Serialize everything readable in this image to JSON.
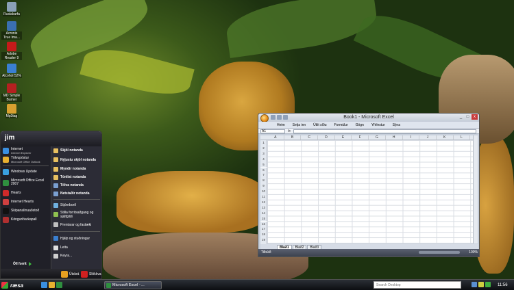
{
  "desktop": {
    "icons": [
      {
        "label": "Ruslakarfa",
        "icon": "recycle-bin-icon",
        "color": "#8aa0b8"
      },
      {
        "label": "Acronis True Ima...",
        "icon": "acronis-icon",
        "color": "#3a6fb0"
      },
      {
        "label": "Adobe Reader 9",
        "icon": "adobe-reader-icon",
        "color": "#c41a1a"
      },
      {
        "label": "Alcohol 52%",
        "icon": "alcohol-icon",
        "color": "#3a7fd0"
      },
      {
        "label": "MD Simple Burner",
        "icon": "md-burner-icon",
        "color": "#b52020"
      },
      {
        "label": "Mp3tag",
        "icon": "mp3tag-icon",
        "color": "#d8a030"
      }
    ]
  },
  "start_menu": {
    "user": "jim",
    "left_items": [
      {
        "label": "Internet",
        "sub": "Internet Explorer",
        "icon": "internet-explorer-icon",
        "color": "#3a8fe0"
      },
      {
        "label": "Tölvupóstur",
        "sub": "Microsoft Office Outlook",
        "icon": "outlook-icon",
        "color": "#e8b030"
      },
      {
        "label": "Windows Update",
        "sub": "",
        "icon": "windows-update-icon",
        "color": "#3aa0e0"
      },
      {
        "label": "Microsoft Office Excel 2007",
        "sub": "",
        "icon": "excel-icon",
        "color": "#2f8f3f"
      },
      {
        "label": "Hearts",
        "sub": "",
        "icon": "hearts-icon",
        "color": "#d02a2a"
      },
      {
        "label": "Internet Hearts",
        "sub": "",
        "icon": "internet-hearts-icon",
        "color": "#d04040"
      },
      {
        "label": "Skipanalínuaðstoð",
        "sub": "",
        "icon": "command-prompt-icon",
        "color": "#111111"
      },
      {
        "label": "Köngurlóarkapall",
        "sub": "",
        "icon": "spider-solitaire-icon",
        "color": "#b03030"
      }
    ],
    "all_programs": "Öll forrit",
    "right_items": [
      {
        "label": "Skjöl notanda",
        "icon": "documents-icon",
        "color": "#e8c060",
        "bold": true
      },
      {
        "label": "Nýjustu skjöl notanda",
        "icon": "recent-docs-icon",
        "color": "#e8c060",
        "bold": true
      },
      {
        "label": "Myndir notanda",
        "icon": "pictures-icon",
        "color": "#e8c060",
        "bold": true
      },
      {
        "label": "Tónlist notanda",
        "icon": "music-icon",
        "color": "#e8c060",
        "bold": true
      },
      {
        "label": "Tölva notanda",
        "icon": "computer-icon",
        "color": "#7a9fd0",
        "bold": true
      },
      {
        "label": "Netstaðir notanda",
        "icon": "network-icon",
        "color": "#7a9fd0",
        "bold": true
      },
      {
        "label": "Stjórnborð",
        "icon": "control-panel-icon",
        "color": "#6fb0e0",
        "bold": false
      },
      {
        "label": "Stilla forritsaðgang og sjálfgildi",
        "icon": "program-defaults-icon",
        "color": "#8fc050",
        "bold": false
      },
      {
        "label": "Prentarar og faxtæki",
        "icon": "printers-icon",
        "color": "#c0c0c0",
        "bold": false
      },
      {
        "label": "Hjálp og stuðningur",
        "icon": "help-icon",
        "color": "#3a7fd0",
        "bold": false
      },
      {
        "label": "Leita",
        "icon": "search-icon",
        "color": "#e0e0e0",
        "bold": false
      },
      {
        "label": "Keyra...",
        "icon": "run-icon",
        "color": "#d0d0d0",
        "bold": false
      }
    ],
    "footer": {
      "logoff": "Útskrá",
      "shutdown": "Slökkva"
    }
  },
  "excel": {
    "title": "Book1 - Microsoft Excel",
    "menu": [
      "Heim",
      "Setja inn",
      "Útlit síðu",
      "Formúlur",
      "Gögn",
      "Yfirlestur",
      "Sýna"
    ],
    "name_box": "A1",
    "fx": "fx",
    "columns": [
      "A",
      "B",
      "C",
      "D",
      "E",
      "F",
      "G",
      "H",
      "I",
      "J",
      "K",
      "L"
    ],
    "rows": [
      "1",
      "2",
      "3",
      "4",
      "5",
      "6",
      "7",
      "8",
      "9",
      "10",
      "11",
      "12",
      "13",
      "14",
      "15",
      "16",
      "17",
      "18",
      "19",
      "20"
    ],
    "sheets": [
      "Blað1",
      "Blað2",
      "Blað3"
    ],
    "status": "Tilbúið",
    "zoom": "100%"
  },
  "taskbar": {
    "start_label": "ræsa",
    "task": "Microsoft Excel - ...",
    "search_placeholder": "Search Desktop",
    "clock": "11:56"
  }
}
